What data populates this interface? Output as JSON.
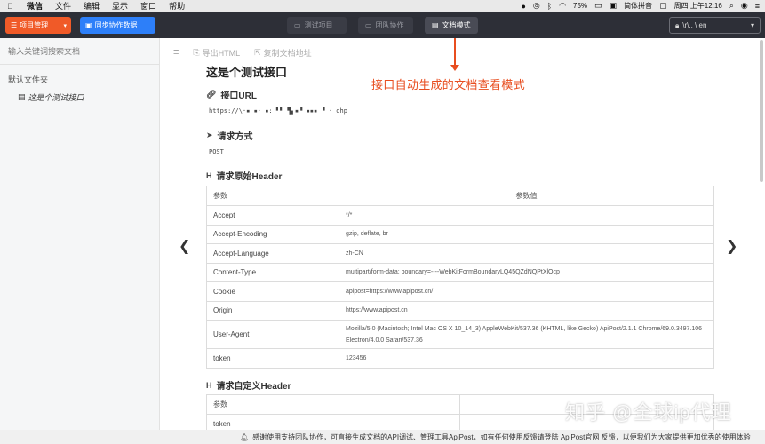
{
  "menubar": {
    "app_name": "微信",
    "items": [
      "文件",
      "编辑",
      "显示",
      "窗口",
      "帮助"
    ],
    "battery": "75%",
    "input_method": "简体拼音",
    "clock": "周四 上午12:16"
  },
  "toolbar": {
    "project_label": "项目管理",
    "sync_label": "同步协作数据",
    "tabs": [
      "测试项目",
      "团队协作",
      "文档模式"
    ],
    "active_tab": "文档模式",
    "user_label": "\\r\\.. \\ en"
  },
  "sidebar": {
    "search_placeholder": "输入关键词搜索文档",
    "folder_label": "默认文件夹",
    "doc_label": "这是个测试接口"
  },
  "main_toolbar": {
    "export_html": "导出HTML",
    "copy_doc_url": "复制文档地址"
  },
  "doc": {
    "title": "这是个测试接口",
    "url_heading": "接口URL",
    "url_value": "https://\\·▪  ▪· ▪: ▘▘  ▜▖▪▝  ▪▪▪ ▝  ·  ohp",
    "method_heading": "请求方式",
    "method_value": "POST",
    "orig_header_heading": "请求原始Header",
    "custom_header_heading": "请求自定义Header",
    "table_col_param": "参数",
    "table_col_value": "参数值",
    "orig_rows": [
      {
        "k": "Accept",
        "v": "*/*"
      },
      {
        "k": "Accept-Encoding",
        "v": "gzip, deflate, br"
      },
      {
        "k": "Accept-Language",
        "v": "zh-CN"
      },
      {
        "k": "Content-Type",
        "v": "multipart/form-data; boundary=----WebKitFormBoundaryLQ45QZdNQPtXlOcp"
      },
      {
        "k": "Cookie",
        "v": "apipost=https://www.apipost.cn/"
      },
      {
        "k": "Origin",
        "v": "https://www.apipost.cn"
      },
      {
        "k": "User-Agent",
        "v": "Mozilla/5.0 (Macintosh; Intel Mac OS X 10_14_3) AppleWebKit/537.36 (KHTML, like Gecko) ApiPost/2.1.1 Chrome/69.0.3497.106 Electron/4.0.0 Safari/537.36"
      },
      {
        "k": "token",
        "v": "123456"
      }
    ],
    "custom_rows": [
      {
        "k": "token",
        "v": ""
      }
    ]
  },
  "callout": "接口自动生成的文档查看模式",
  "footer": "感谢使用支持团队协作，可直接生成文档的API调试、管理工具ApiPost，如有任何使用反馈请登陆 ApiPost官网 反馈，以便我们为大家提供更加优秀的使用体验",
  "watermark": "知乎 @全球ip代理",
  "colors": {
    "toolbar_bg": "#2d2f37",
    "project_btn": "#f05a28",
    "sync_btn": "#2d7ff9",
    "callout": "#e84d1f"
  }
}
